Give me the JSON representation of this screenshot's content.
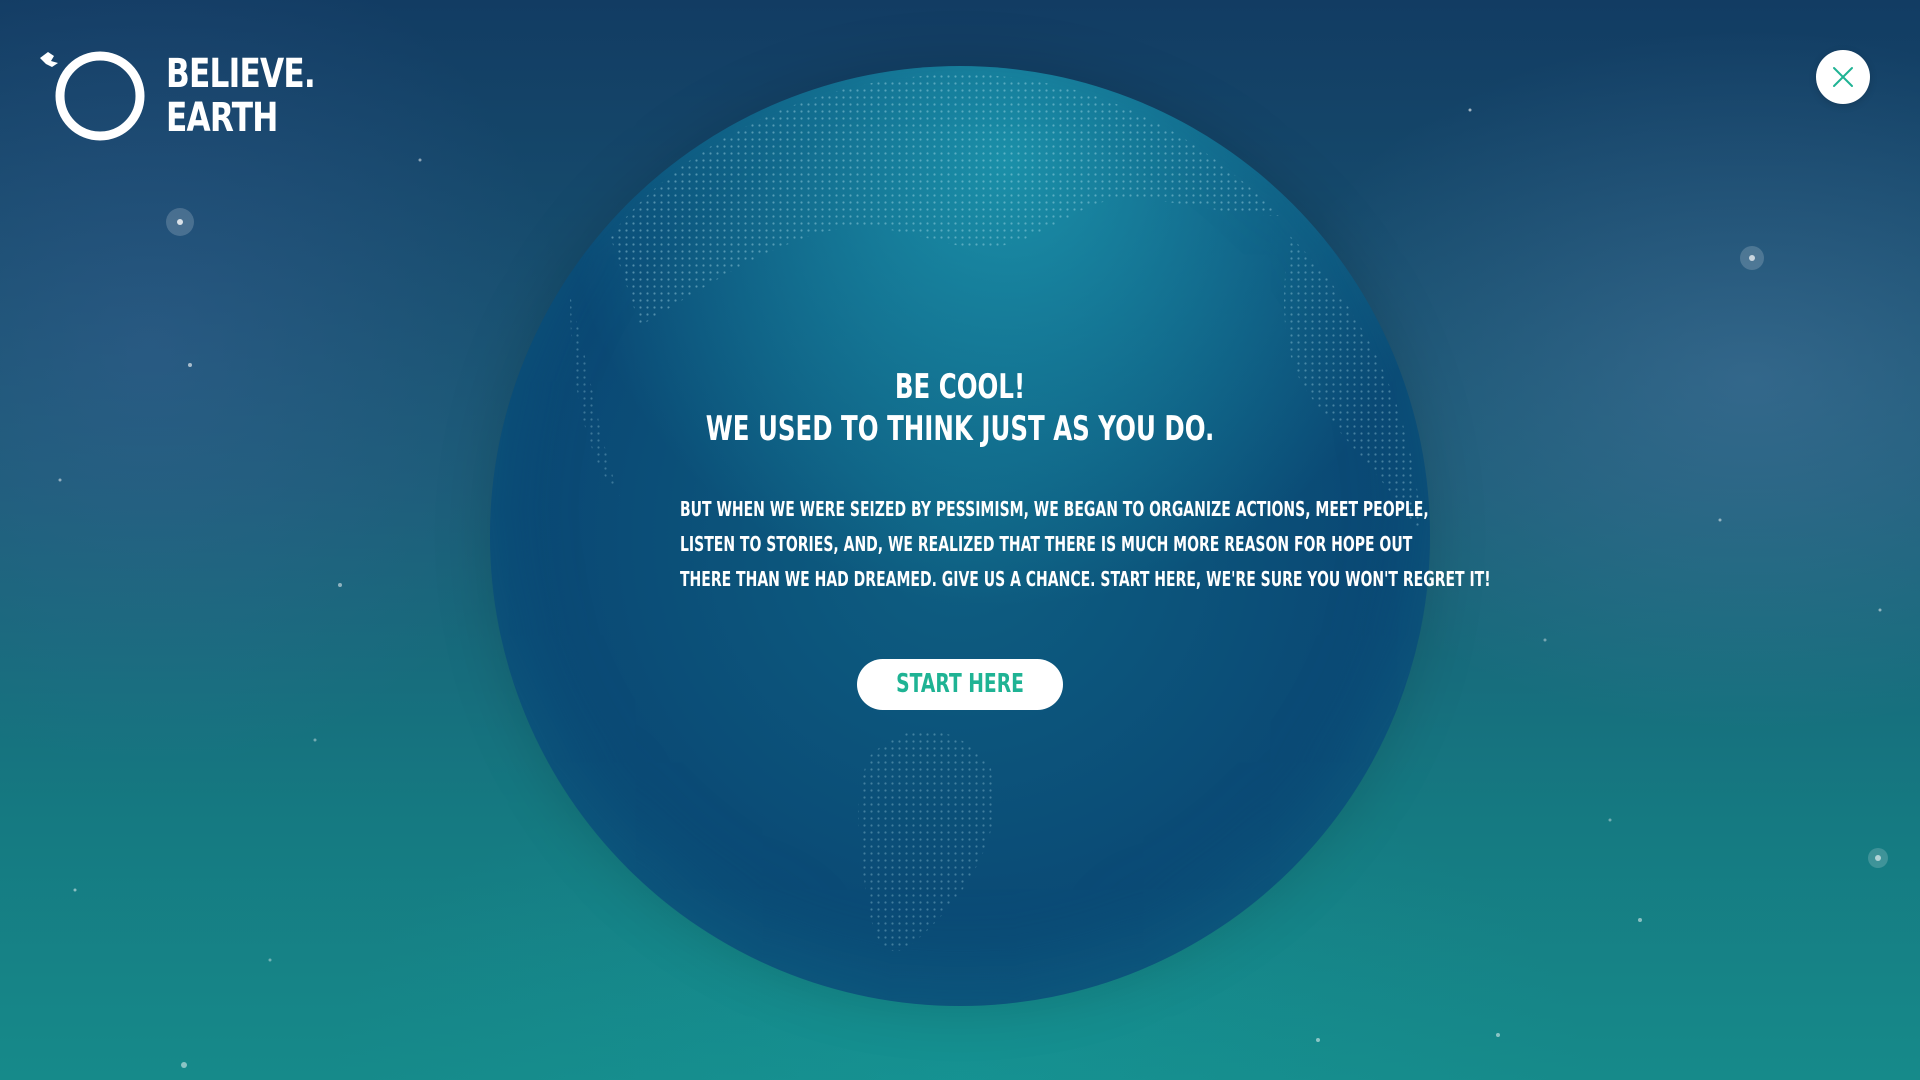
{
  "brand": {
    "line1": "BELIEVE.",
    "line2": "EARTH",
    "logo_icon": "circle-dove-icon"
  },
  "close_button": {
    "icon": "close-icon"
  },
  "dialog": {
    "headline_line1": "BE COOL!",
    "headline_line2": "WE USED TO THINK JUST AS YOU DO.",
    "body_line1": "BUT WHEN WE WERE SEIZED BY PESSIMISM, WE BEGAN TO ORGANIZE ACTIONS, MEET PEOPLE,",
    "body_line2": "LISTEN TO STORIES, AND, WE REALIZED THAT THERE IS MUCH MORE REASON FOR HOPE OUT",
    "body_line3": "THERE THAN WE HAD DREAMED. GIVE US A CHANCE. START HERE, WE'RE SURE YOU WON'T REGRET IT!",
    "cta_label": "START HERE"
  },
  "colors": {
    "accent": "#1fb394",
    "text": "#ffffff",
    "background_top": "#123c63",
    "background_bottom": "#168a8a",
    "globe": "#0b4f78"
  }
}
